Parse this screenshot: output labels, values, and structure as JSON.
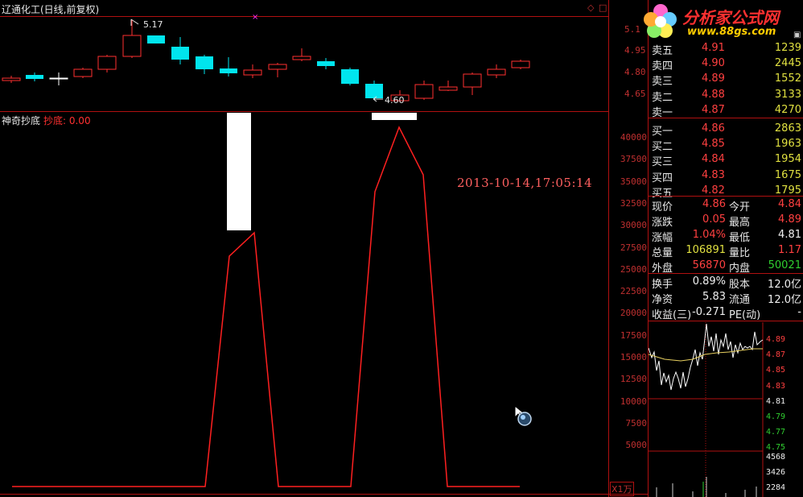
{
  "header": {
    "title": "辽通化工(日线,前复权)"
  },
  "indicator": {
    "name": "神奇抄底",
    "label": "抄底: 0.00"
  },
  "timestamp": "2013-10-14,17:05:14",
  "annotations": {
    "high": "5.17",
    "low": "4.60"
  },
  "price_axis": [
    "5.1",
    "4.95",
    "4.80",
    "4.65"
  ],
  "volume_axis": [
    "40000",
    "37500",
    "35000",
    "32500",
    "30000",
    "27500",
    "25000",
    "22500",
    "20000",
    "17500",
    "15000",
    "12500",
    "10000",
    "7500",
    "5000"
  ],
  "volume_unit": "X1万",
  "logo": {
    "text": "分析家公式网",
    "url": "www.88gs.com"
  },
  "order_book": [
    {
      "label": "卖五",
      "price": "4.91",
      "vol": "1239"
    },
    {
      "label": "卖四",
      "price": "4.90",
      "vol": "2445"
    },
    {
      "label": "卖三",
      "price": "4.89",
      "vol": "1552"
    },
    {
      "label": "卖二",
      "price": "4.88",
      "vol": "3133"
    },
    {
      "label": "卖一",
      "price": "4.87",
      "vol": "4270"
    },
    {
      "label": "买一",
      "price": "4.86",
      "vol": "2863"
    },
    {
      "label": "买二",
      "price": "4.85",
      "vol": "1963"
    },
    {
      "label": "买三",
      "price": "4.84",
      "vol": "1954"
    },
    {
      "label": "买四",
      "price": "4.83",
      "vol": "1675"
    },
    {
      "label": "买五",
      "price": "4.82",
      "vol": "1795"
    }
  ],
  "quote": [
    {
      "l1": "现价",
      "v1": "4.86",
      "c1": "red",
      "l2": "今开",
      "v2": "4.84",
      "c2": "red"
    },
    {
      "l1": "涨跌",
      "v1": "0.05",
      "c1": "red",
      "l2": "最高",
      "v2": "4.89",
      "c2": "red"
    },
    {
      "l1": "涨幅",
      "v1": "1.04%",
      "c1": "red",
      "l2": "最低",
      "v2": "4.81",
      "c2": "white"
    },
    {
      "l1": "总量",
      "v1": "106891",
      "c1": "yellow",
      "l2": "量比",
      "v2": "1.17",
      "c2": "red"
    },
    {
      "l1": "外盘",
      "v1": "56870",
      "c1": "red",
      "l2": "内盘",
      "v2": "50021",
      "c2": "green"
    }
  ],
  "stats": [
    {
      "l1": "换手",
      "v1": "0.89%",
      "l2": "股本",
      "v2": "12.0亿"
    },
    {
      "l1": "净资",
      "v1": "5.83",
      "l2": "流通",
      "v2": "12.0亿"
    },
    {
      "l1": "收益(三)",
      "v1": "-0.271",
      "l2": "PE(动)",
      "v2": "-"
    }
  ],
  "mini_price_axis": [
    {
      "v": "4.89",
      "c": "#ff4040"
    },
    {
      "v": "4.87",
      "c": "#ff4040"
    },
    {
      "v": "4.85",
      "c": "#ff4040"
    },
    {
      "v": "4.83",
      "c": "#ff4040"
    },
    {
      "v": "4.81",
      "c": "#f0f0f0"
    },
    {
      "v": "4.79",
      "c": "#30d030"
    },
    {
      "v": "4.77",
      "c": "#30d030"
    },
    {
      "v": "4.75",
      "c": "#30d030"
    }
  ],
  "mini_vol_axis": [
    "4568",
    "3426",
    "2284"
  ],
  "colors": {
    "up": "#ff3030",
    "down": "#00e5ee",
    "indicator": "#ff2020",
    "frame": "#b01010"
  }
}
